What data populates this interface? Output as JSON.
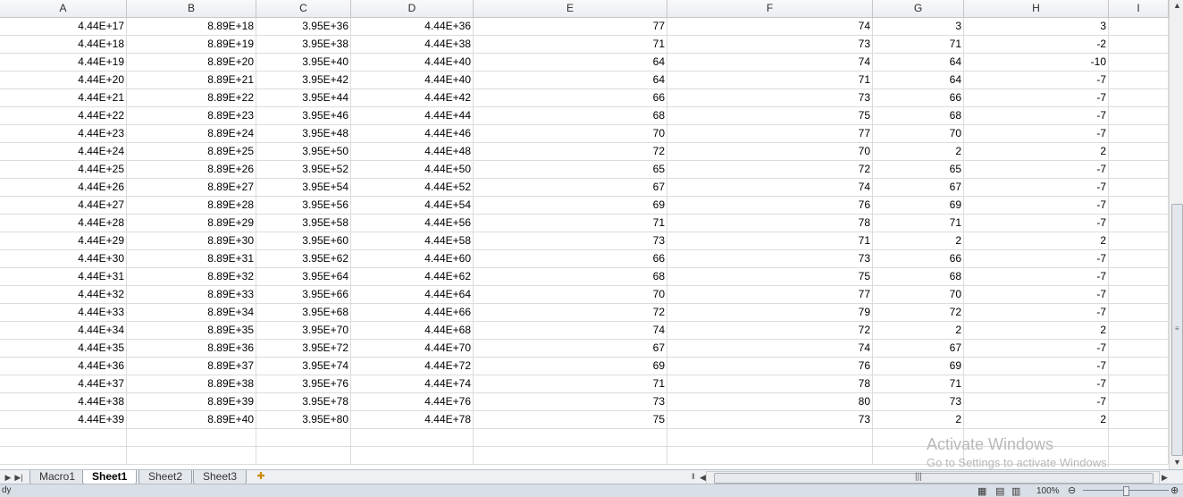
{
  "columns": [
    "A",
    "B",
    "C",
    "D",
    "E",
    "F",
    "G",
    "H",
    "I"
  ],
  "rows": [
    [
      "4.44E+17",
      "8.89E+18",
      "3.95E+36",
      "4.44E+36",
      "77",
      "74",
      "3",
      "3",
      ""
    ],
    [
      "4.44E+18",
      "8.89E+19",
      "3.95E+38",
      "4.44E+38",
      "71",
      "73",
      "71",
      "-2",
      ""
    ],
    [
      "4.44E+19",
      "8.89E+20",
      "3.95E+40",
      "4.44E+40",
      "64",
      "74",
      "64",
      "-10",
      ""
    ],
    [
      "4.44E+20",
      "8.89E+21",
      "3.95E+42",
      "4.44E+40",
      "64",
      "71",
      "64",
      "-7",
      ""
    ],
    [
      "4.44E+21",
      "8.89E+22",
      "3.95E+44",
      "4.44E+42",
      "66",
      "73",
      "66",
      "-7",
      ""
    ],
    [
      "4.44E+22",
      "8.89E+23",
      "3.95E+46",
      "4.44E+44",
      "68",
      "75",
      "68",
      "-7",
      ""
    ],
    [
      "4.44E+23",
      "8.89E+24",
      "3.95E+48",
      "4.44E+46",
      "70",
      "77",
      "70",
      "-7",
      ""
    ],
    [
      "4.44E+24",
      "8.89E+25",
      "3.95E+50",
      "4.44E+48",
      "72",
      "70",
      "2",
      "2",
      ""
    ],
    [
      "4.44E+25",
      "8.89E+26",
      "3.95E+52",
      "4.44E+50",
      "65",
      "72",
      "65",
      "-7",
      ""
    ],
    [
      "4.44E+26",
      "8.89E+27",
      "3.95E+54",
      "4.44E+52",
      "67",
      "74",
      "67",
      "-7",
      ""
    ],
    [
      "4.44E+27",
      "8.89E+28",
      "3.95E+56",
      "4.44E+54",
      "69",
      "76",
      "69",
      "-7",
      ""
    ],
    [
      "4.44E+28",
      "8.89E+29",
      "3.95E+58",
      "4.44E+56",
      "71",
      "78",
      "71",
      "-7",
      ""
    ],
    [
      "4.44E+29",
      "8.89E+30",
      "3.95E+60",
      "4.44E+58",
      "73",
      "71",
      "2",
      "2",
      ""
    ],
    [
      "4.44E+30",
      "8.89E+31",
      "3.95E+62",
      "4.44E+60",
      "66",
      "73",
      "66",
      "-7",
      ""
    ],
    [
      "4.44E+31",
      "8.89E+32",
      "3.95E+64",
      "4.44E+62",
      "68",
      "75",
      "68",
      "-7",
      ""
    ],
    [
      "4.44E+32",
      "8.89E+33",
      "3.95E+66",
      "4.44E+64",
      "70",
      "77",
      "70",
      "-7",
      ""
    ],
    [
      "4.44E+33",
      "8.89E+34",
      "3.95E+68",
      "4.44E+66",
      "72",
      "79",
      "72",
      "-7",
      ""
    ],
    [
      "4.44E+34",
      "8.89E+35",
      "3.95E+70",
      "4.44E+68",
      "74",
      "72",
      "2",
      "2",
      ""
    ],
    [
      "4.44E+35",
      "8.89E+36",
      "3.95E+72",
      "4.44E+70",
      "67",
      "74",
      "67",
      "-7",
      ""
    ],
    [
      "4.44E+36",
      "8.89E+37",
      "3.95E+74",
      "4.44E+72",
      "69",
      "76",
      "69",
      "-7",
      ""
    ],
    [
      "4.44E+37",
      "8.89E+38",
      "3.95E+76",
      "4.44E+74",
      "71",
      "78",
      "71",
      "-7",
      ""
    ],
    [
      "4.44E+38",
      "8.89E+39",
      "3.95E+78",
      "4.44E+76",
      "73",
      "80",
      "73",
      "-7",
      ""
    ],
    [
      "4.44E+39",
      "8.89E+40",
      "3.95E+80",
      "4.44E+78",
      "75",
      "73",
      "2",
      "2",
      ""
    ],
    [
      "",
      "",
      "",
      "",
      "",
      "",
      "",
      "",
      ""
    ],
    [
      "",
      "",
      "",
      "",
      "",
      "",
      "",
      "",
      ""
    ]
  ],
  "sheet_tabs": [
    {
      "label": "Macro1",
      "active": false
    },
    {
      "label": "Sheet1",
      "active": true
    },
    {
      "label": "Sheet2",
      "active": false
    },
    {
      "label": "Sheet3",
      "active": false
    }
  ],
  "status": {
    "left": "dy",
    "zoom": "100%"
  },
  "watermark": {
    "line1": "Activate Windows",
    "line2": "Go to Settings to activate Windows."
  },
  "icons": {
    "first_sheet": "first-sheet-icon",
    "last_sheet": "last-sheet-icon",
    "new_sheet": "new-sheet-icon",
    "scroll_up": "scroll-up-icon",
    "scroll_down": "scroll-down-icon"
  }
}
